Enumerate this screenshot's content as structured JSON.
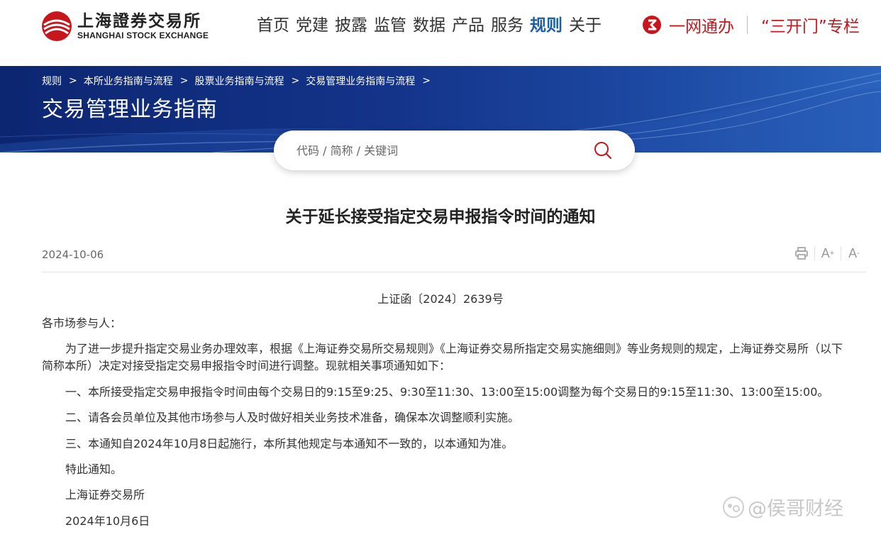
{
  "header": {
    "logo_cn": "上海證券交易所",
    "logo_en": "SHANGHAI STOCK EXCHANGE",
    "nav": [
      {
        "label": "首页"
      },
      {
        "label": "党建"
      },
      {
        "label": "披露"
      },
      {
        "label": "监管"
      },
      {
        "label": "数据"
      },
      {
        "label": "产品"
      },
      {
        "label": "服务"
      },
      {
        "label": "规则",
        "active": true
      },
      {
        "label": "关于"
      }
    ],
    "ywtb_label": "一网通办",
    "skm_label": "“三开门”专栏"
  },
  "banner": {
    "breadcrumb": [
      "规则",
      "本所业务指南与流程",
      "股票业务指南与流程",
      "交易管理业务指南与流程"
    ],
    "title": "交易管理业务指南"
  },
  "search": {
    "placeholder": "代码 / 简称 / 关键词"
  },
  "article": {
    "title": "关于延长接受指定交易申报指令时间的通知",
    "date": "2024-10-06",
    "doc_no": "上证函〔2024〕2639号",
    "salutation": "各市场参与人：",
    "para1_line1": "为了进一步提升指定交易业务办理效率，根据《上海证券交易所交易规则》《上海证券交易所指定交易实施细则》等业务规则的规定，上海证券交易所（以下",
    "para1_line2": "简称本所）决定对接受指定交易申报指令时间进行调整。现就相关事项通知如下：",
    "item1": "一、本所接受指定交易申报指令时间由每个交易日的9:15至9:25、9:30至11:30、13:00至15:00调整为每个交易日的9:15至11:30、13:00至15:00。",
    "item2": "二、请各会员单位及其他市场参与人及时做好相关业务技术准备，确保本次调整顺利实施。",
    "item3": "三、本通知自2024年10月8日起施行，本所其他规定与本通知不一致的，以本通知为准。",
    "closing": "特此通知。",
    "signature": "上海证券交易所",
    "sign_date": "2024年10月6日"
  },
  "tools": {
    "font_increase": "A",
    "font_decrease": "A"
  },
  "watermark": "@侯哥财经",
  "colors": {
    "brand_red": "#c8161d",
    "nav_active": "#1b5fa8",
    "banner_blue": "#14348a"
  }
}
